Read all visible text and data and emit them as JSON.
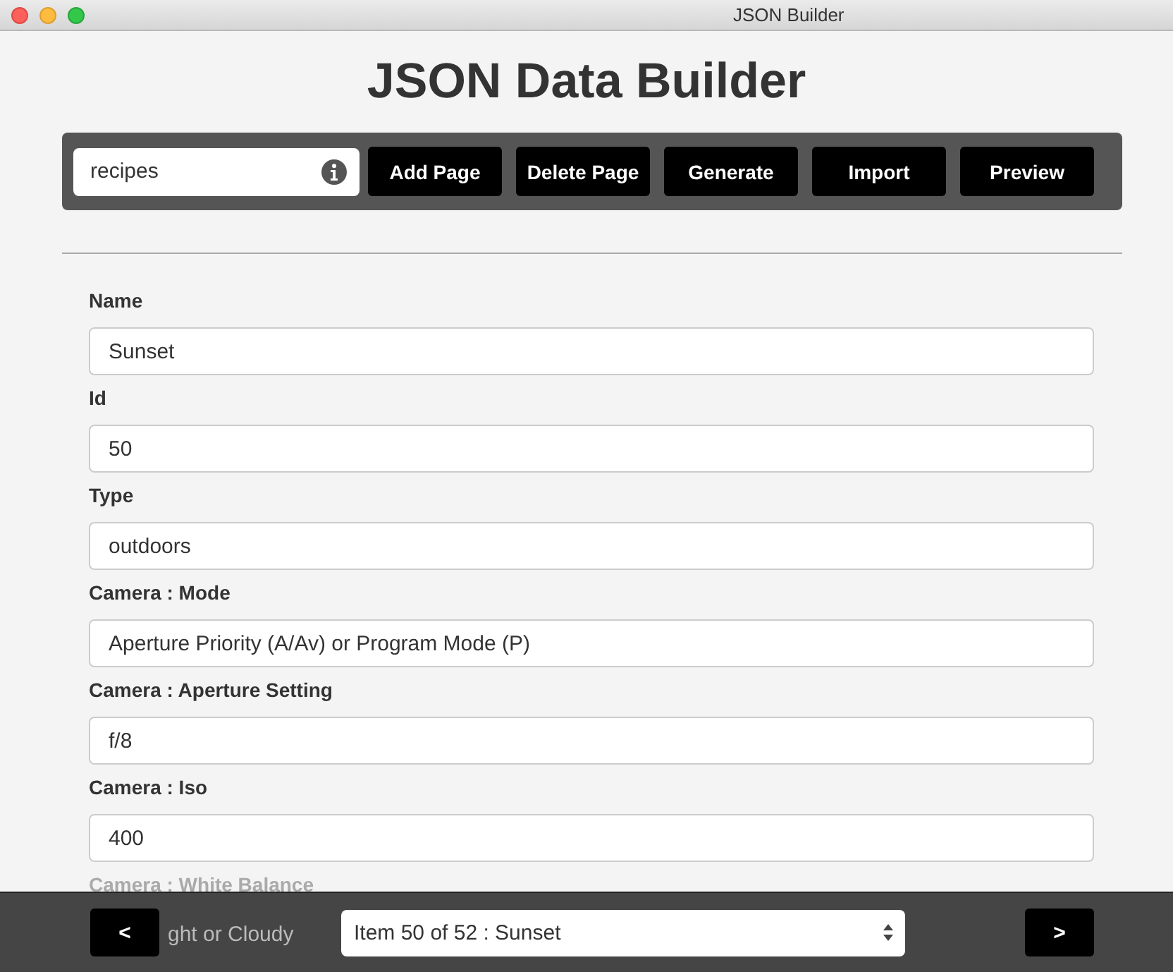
{
  "window": {
    "title": "JSON Builder"
  },
  "heading": "JSON Data Builder",
  "toolbar": {
    "page_field": {
      "value": "recipes"
    },
    "buttons": [
      "Add Page",
      "Delete Page",
      "Generate",
      "Import",
      "Preview"
    ]
  },
  "fields": [
    {
      "label": "Name",
      "value": "Sunset",
      "kind": "full"
    },
    {
      "label": "Id",
      "value": "50",
      "kind": "full"
    },
    {
      "label": "Type",
      "value": "outdoors",
      "kind": "full"
    },
    {
      "label": "Camera : Mode",
      "value": "Aperture Priority (A/Av) or Program Mode (P)",
      "kind": "full"
    },
    {
      "label": "Camera : Aperture Setting",
      "value": "f/8",
      "kind": "full"
    },
    {
      "label": "Camera : Iso",
      "value": "400",
      "kind": "full"
    },
    {
      "label": "Camera : White Balance",
      "value": "ght or Cloudy",
      "kind": "cut"
    }
  ],
  "footer": {
    "prev": "<",
    "select": "Item 50 of 52 : Sunset",
    "next": ">"
  }
}
